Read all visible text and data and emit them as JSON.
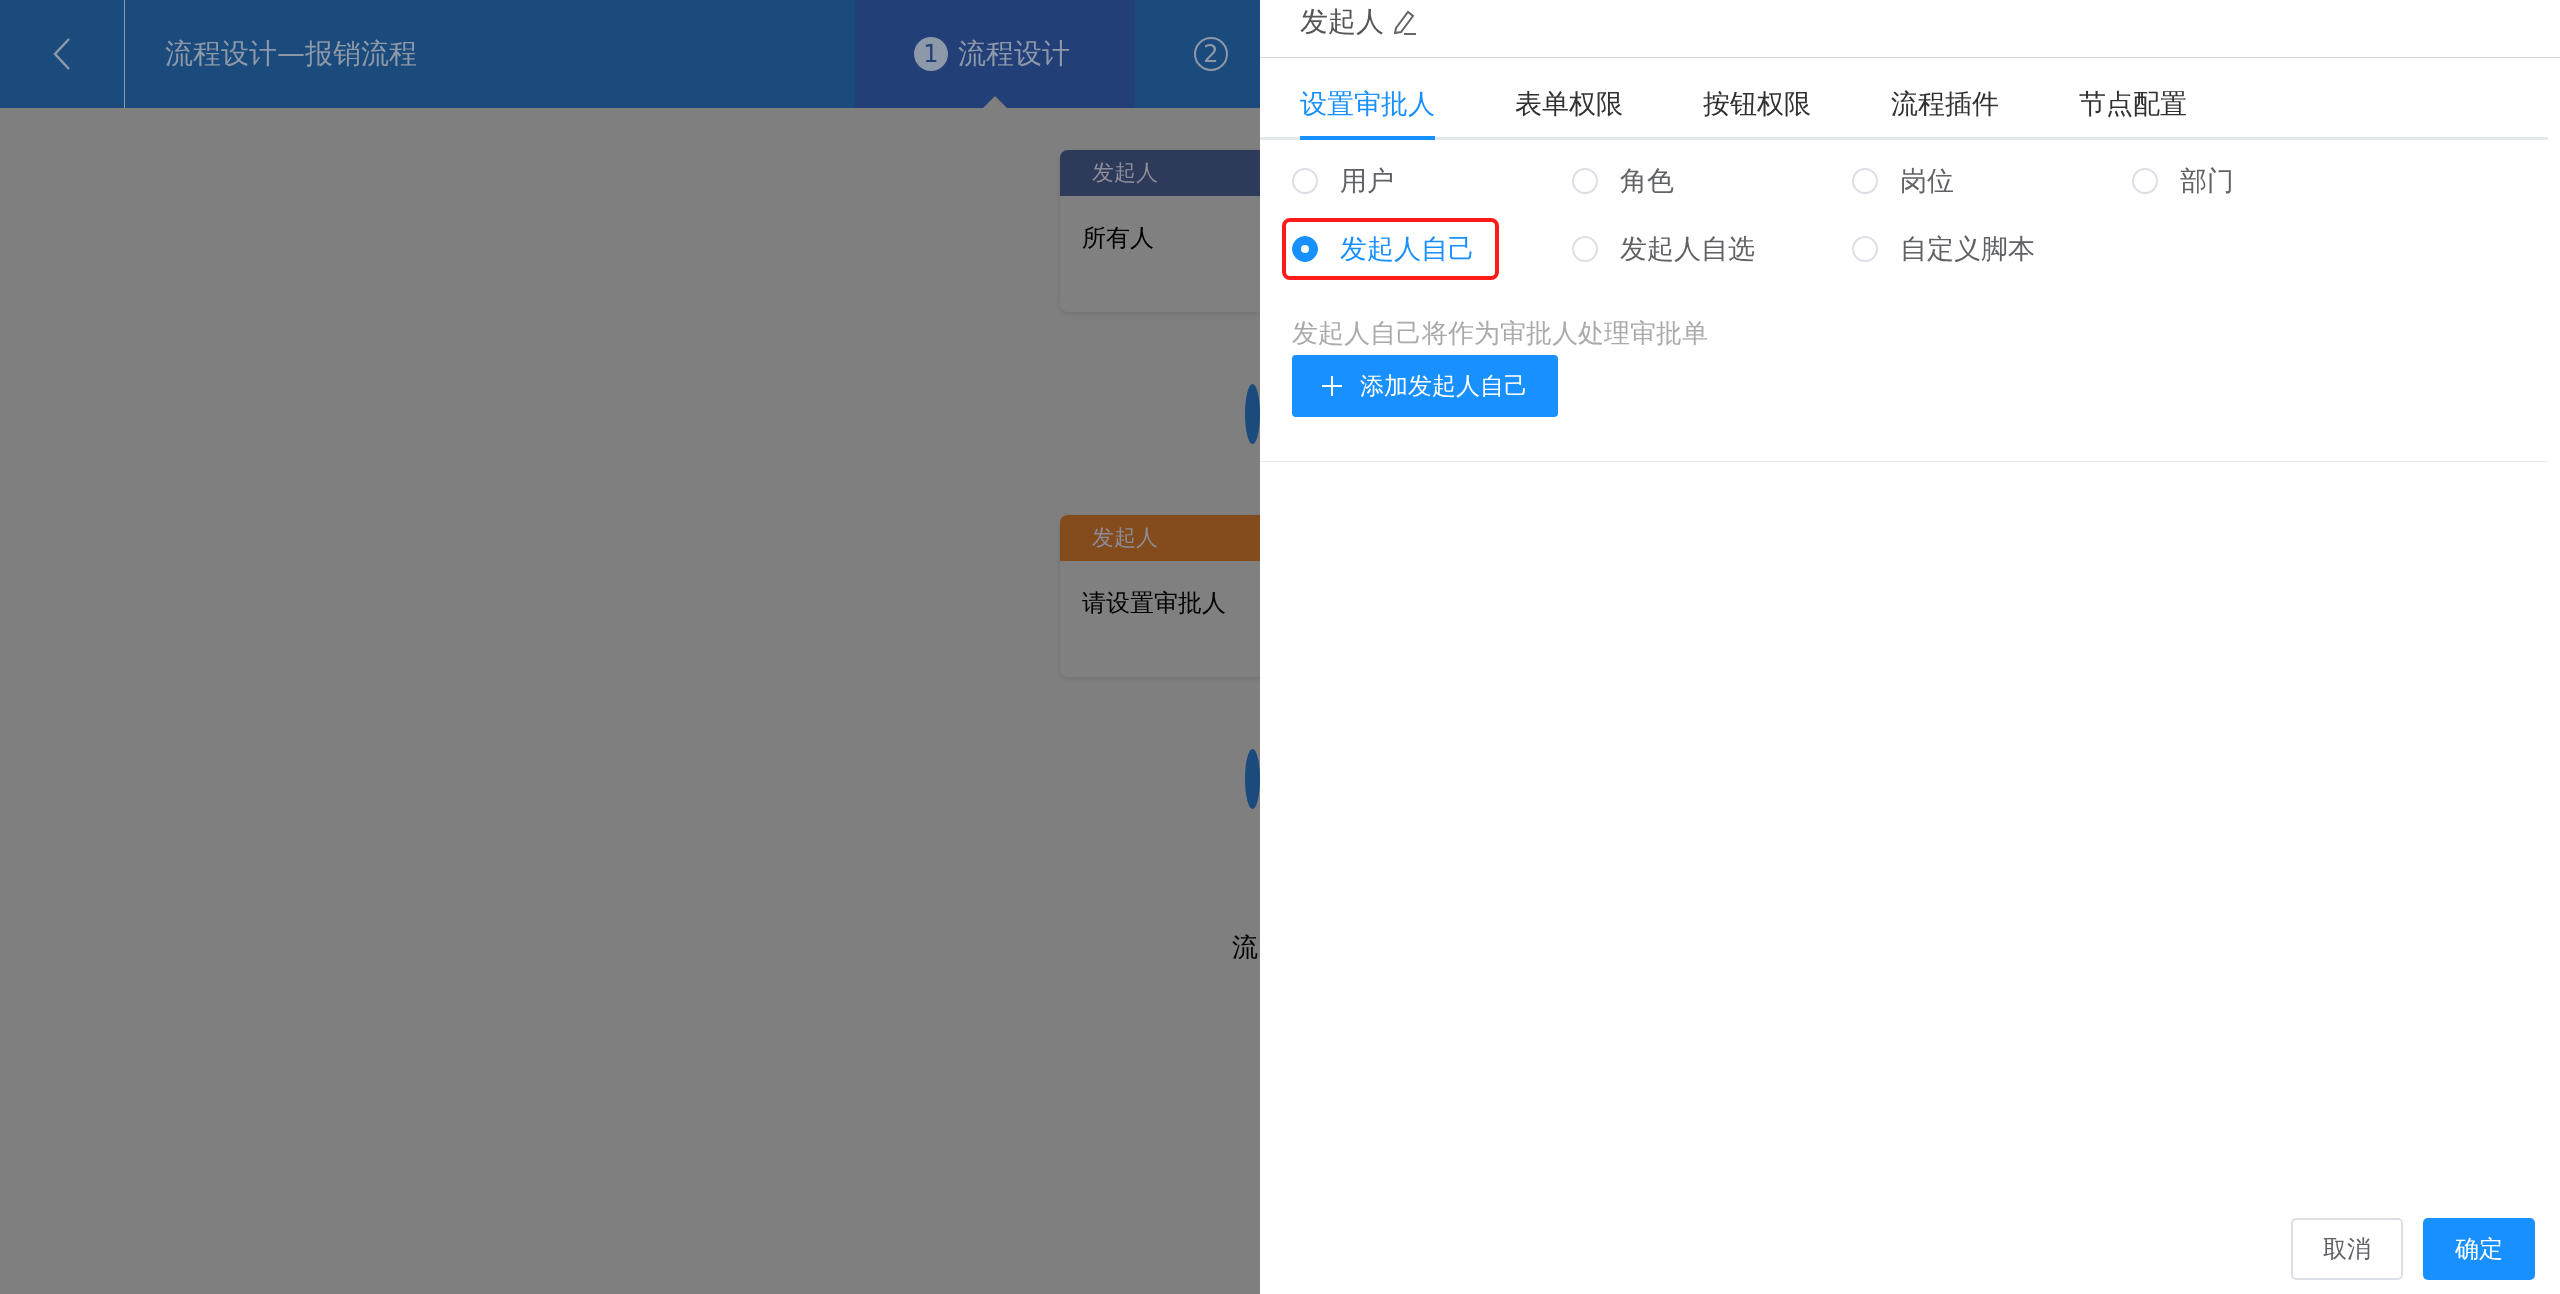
{
  "header": {
    "title": "流程设计—报销流程",
    "steps": [
      {
        "number": "1",
        "label": "流程设计",
        "selected": true
      },
      {
        "number": "2",
        "selected": false
      }
    ]
  },
  "canvas": {
    "nodes": [
      {
        "title": "发起人",
        "content": "所有人",
        "color": "#2d3a5a"
      },
      {
        "title": "发起人",
        "content": "请设置审批人",
        "color": "#844b1d"
      }
    ],
    "footer_text": "流"
  },
  "drawer": {
    "title": "发起人",
    "tabs": [
      {
        "label": "设置审批人",
        "selected": true
      },
      {
        "label": "表单权限",
        "selected": false
      },
      {
        "label": "按钮权限",
        "selected": false
      },
      {
        "label": "流程插件",
        "selected": false
      },
      {
        "label": "节点配置",
        "selected": false
      }
    ],
    "options": [
      {
        "label": "用户",
        "selected": false,
        "highlighted": false
      },
      {
        "label": "角色",
        "selected": false,
        "highlighted": false
      },
      {
        "label": "岗位",
        "selected": false,
        "highlighted": false
      },
      {
        "label": "部门",
        "selected": false,
        "highlighted": false
      },
      {
        "label": "发起人自己",
        "selected": true,
        "highlighted": true
      },
      {
        "label": "发起人自选",
        "selected": false,
        "highlighted": false
      },
      {
        "label": "自定义脚本",
        "selected": false,
        "highlighted": false
      }
    ],
    "hint": "发起人自己将作为审批人处理审批单",
    "add_button": "添加发起人自己",
    "cancel_button": "取消",
    "confirm_button": "确定"
  }
}
